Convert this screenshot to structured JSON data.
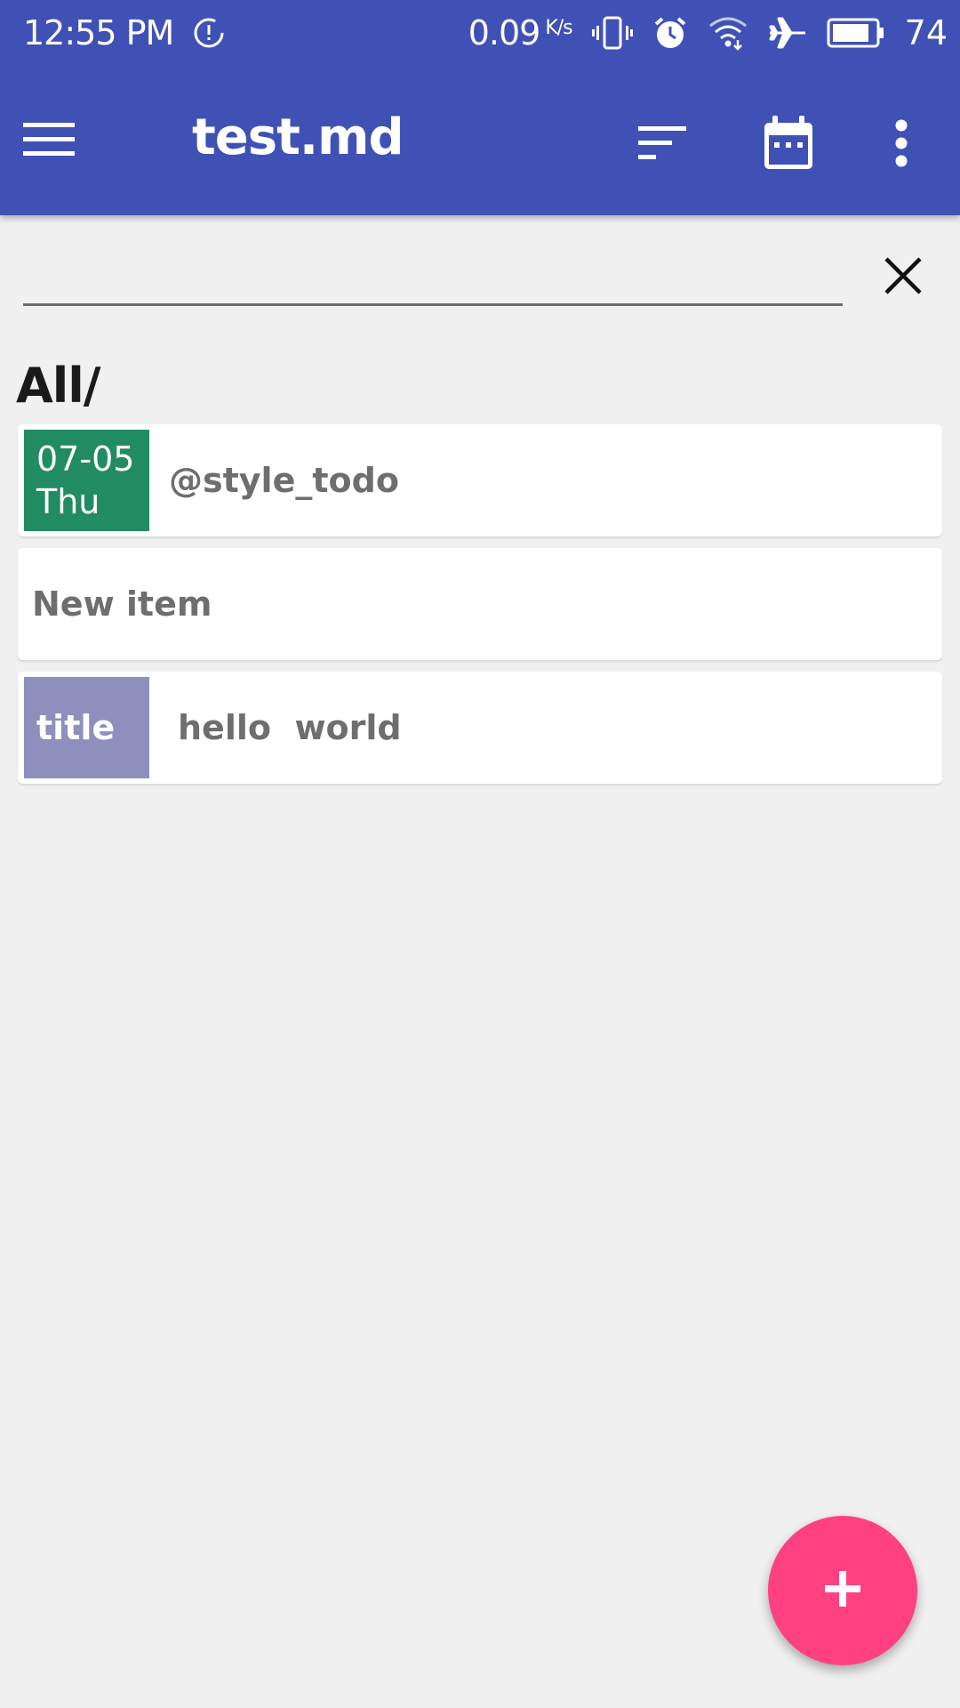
{
  "colors": {
    "primary": "#3f51b5",
    "accent": "#ff4081",
    "background": "#f0f0f0",
    "date_tag": "#218c62",
    "title_tag": "#8e8fbd"
  },
  "status_bar": {
    "time": "12:55 PM",
    "network_speed": "0.09",
    "speed_unit": "K/s",
    "battery": "74",
    "icons": [
      "sync-alert-icon",
      "vibrate-icon",
      "alarm-icon",
      "wifi-icon",
      "airplane-icon",
      "battery-icon"
    ]
  },
  "app_bar": {
    "title": "test.md",
    "icons": [
      "menu-icon",
      "sort-icon",
      "calendar-icon",
      "more-vert-icon"
    ]
  },
  "search": {
    "value": "",
    "clear_icon": "close-icon"
  },
  "folder_title": "All/",
  "items": [
    {
      "tag_line1": "07-05",
      "tag_line2": "Thu",
      "text": "@style_todo"
    },
    {
      "text": "New item"
    },
    {
      "tag": "title",
      "text": "hello  world"
    }
  ],
  "fab": {
    "icon": "plus-icon"
  }
}
